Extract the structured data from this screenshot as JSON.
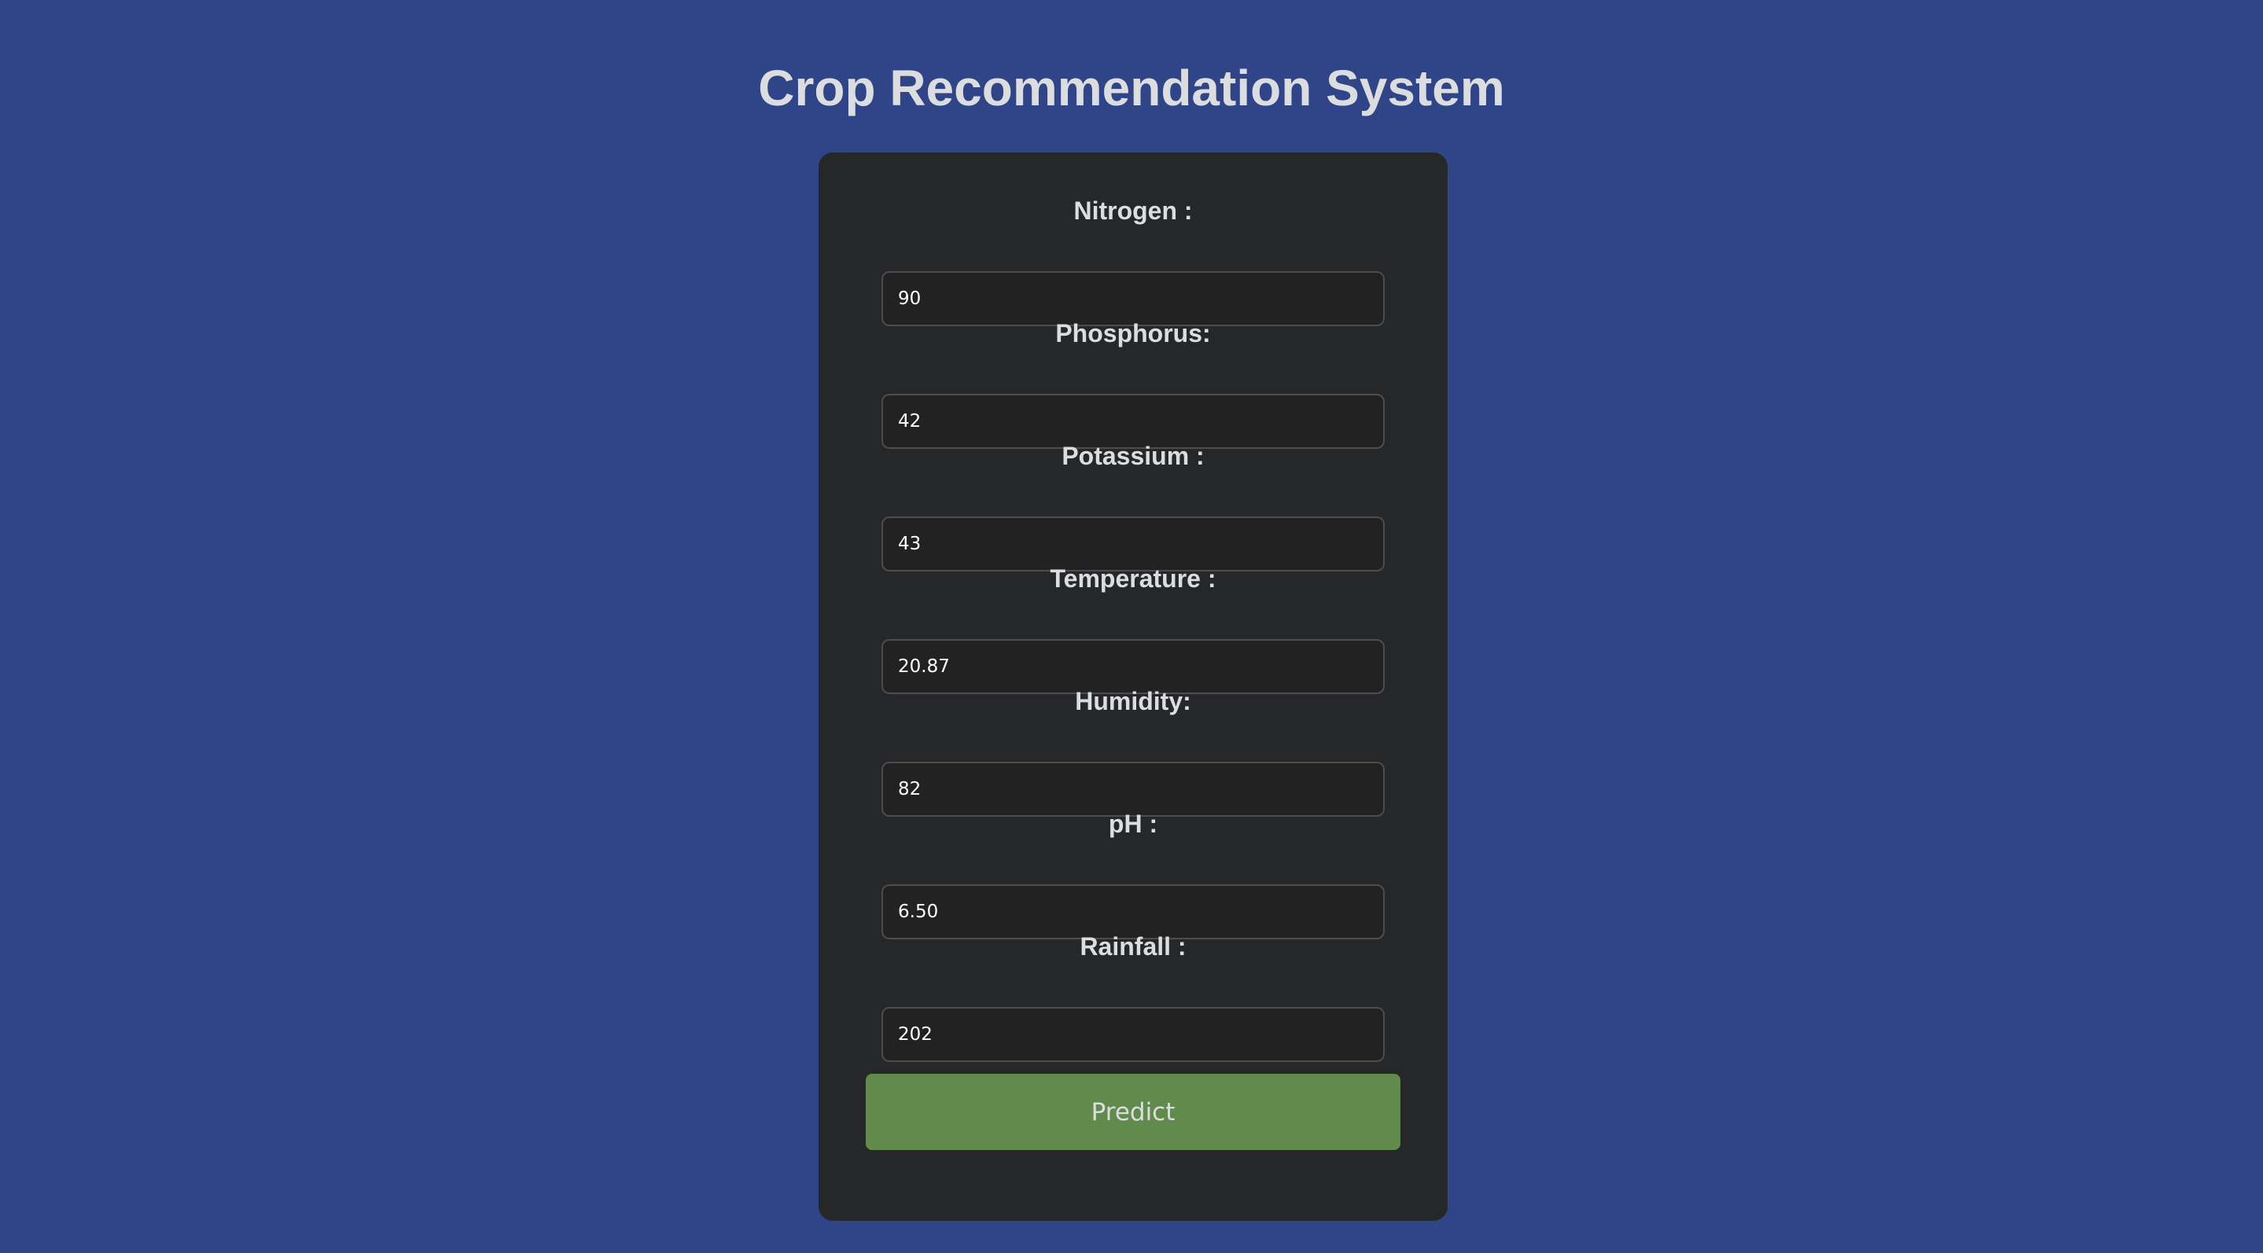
{
  "page": {
    "title": "Crop Recommendation System",
    "background_color": "#2f4587",
    "card_color": "#262729",
    "accent_color": "#628a4c"
  },
  "form": {
    "fields": [
      {
        "label": "Nitrogen :",
        "value": "90"
      },
      {
        "label": "Phosphorus:",
        "value": "42"
      },
      {
        "label": "Potassium :",
        "value": "43"
      },
      {
        "label": "Temperature :",
        "value": "20.87"
      },
      {
        "label": "Humidity:",
        "value": "82"
      },
      {
        "label": "pH :",
        "value": "6.50"
      },
      {
        "label": "Rainfall :",
        "value": "202"
      }
    ],
    "submit_label": "Predict"
  }
}
